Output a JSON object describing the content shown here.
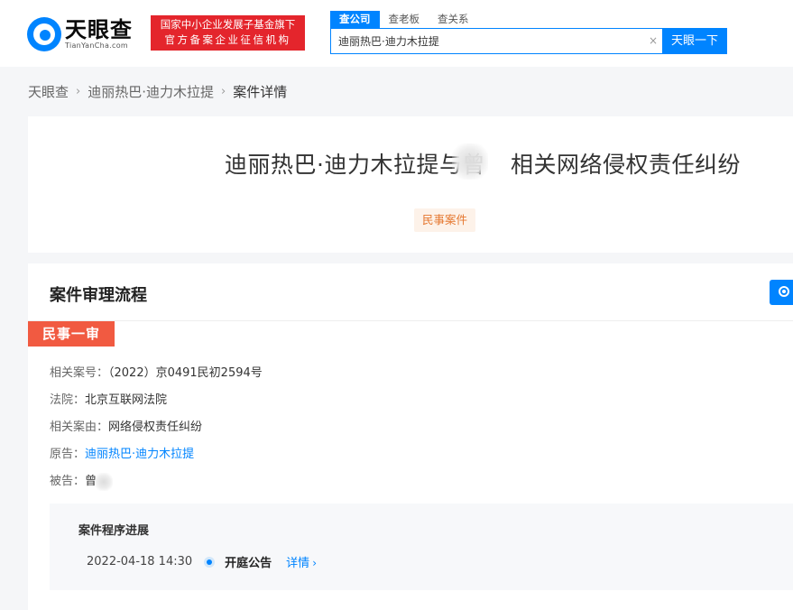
{
  "brand": {
    "name": "天眼查",
    "domain": "TianYanCha.com",
    "badge_line1": "国家中小企业发展子基金旗下",
    "badge_line2": "官方备案企业征信机构"
  },
  "search": {
    "tabs": [
      {
        "label": "查公司",
        "active": true
      },
      {
        "label": "查老板",
        "active": false
      },
      {
        "label": "查关系",
        "active": false
      }
    ],
    "value": "迪丽热巴·迪力木拉提",
    "clear_icon": "×",
    "button_label": "天眼一下"
  },
  "breadcrumb": {
    "items": [
      "天眼查",
      "迪丽热巴·迪力木拉提",
      "案件详情"
    ],
    "separator": "›"
  },
  "case": {
    "title_part1": "迪丽热巴·迪力木拉提与曾",
    "title_part2": "相关网络侵权责任纠纷",
    "type_tag": "民事案件"
  },
  "process": {
    "section_title": "案件审理流程",
    "stage": "民事一审",
    "rows": {
      "case_no": {
        "label": "相关案号：",
        "value": "（2022）京0491民初2594号"
      },
      "court": {
        "label": "法院：",
        "value": "北京互联网法院"
      },
      "cause": {
        "label": "相关案由：",
        "value": "网络侵权责任纠纷"
      },
      "plaintiff": {
        "label": "原告：",
        "value": "迪丽热巴·迪力木拉提"
      },
      "defendant": {
        "label": "被告：",
        "value": "曾"
      }
    },
    "progress": {
      "title": "案件程序进展",
      "items": [
        {
          "time": "2022-04-18 14:30",
          "event": "开庭公告",
          "link": "详情",
          "link_chevron": "›"
        }
      ]
    }
  },
  "colors": {
    "brand_blue": "#0084ff",
    "badge_red": "#e4252c",
    "stage_red": "#f15a41",
    "tag_orange": "#e5772f"
  }
}
